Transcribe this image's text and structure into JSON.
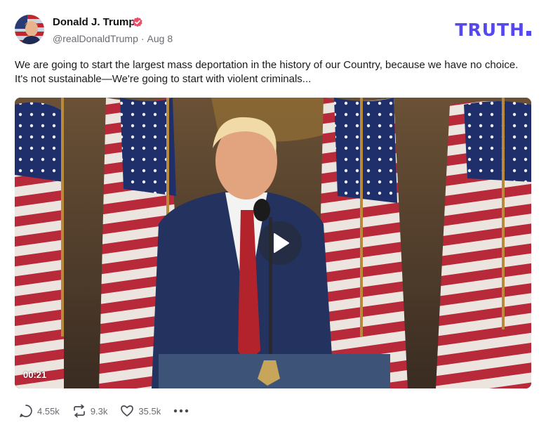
{
  "author": {
    "name": "Donald J. Trump",
    "handle": "@realDonaldTrump",
    "separator": "·",
    "date": "Aug 8"
  },
  "brand": {
    "logo_text": "TRUTH"
  },
  "post": {
    "text": "We are going to start the largest mass deportation in the history of our Country, because we have no choice. It's not sustainable—We're going to start with violent criminals..."
  },
  "video": {
    "duration": "00:21"
  },
  "actions": {
    "replies": "4.55k",
    "retruths": "9.3k",
    "likes": "35.5k"
  },
  "colors": {
    "brand": "#5448ee",
    "verified": "#e8506a",
    "muted": "#6b6b73"
  },
  "icons": [
    "verified-badge-icon",
    "play-icon",
    "reply-icon",
    "retruth-icon",
    "like-icon",
    "more-icon"
  ]
}
